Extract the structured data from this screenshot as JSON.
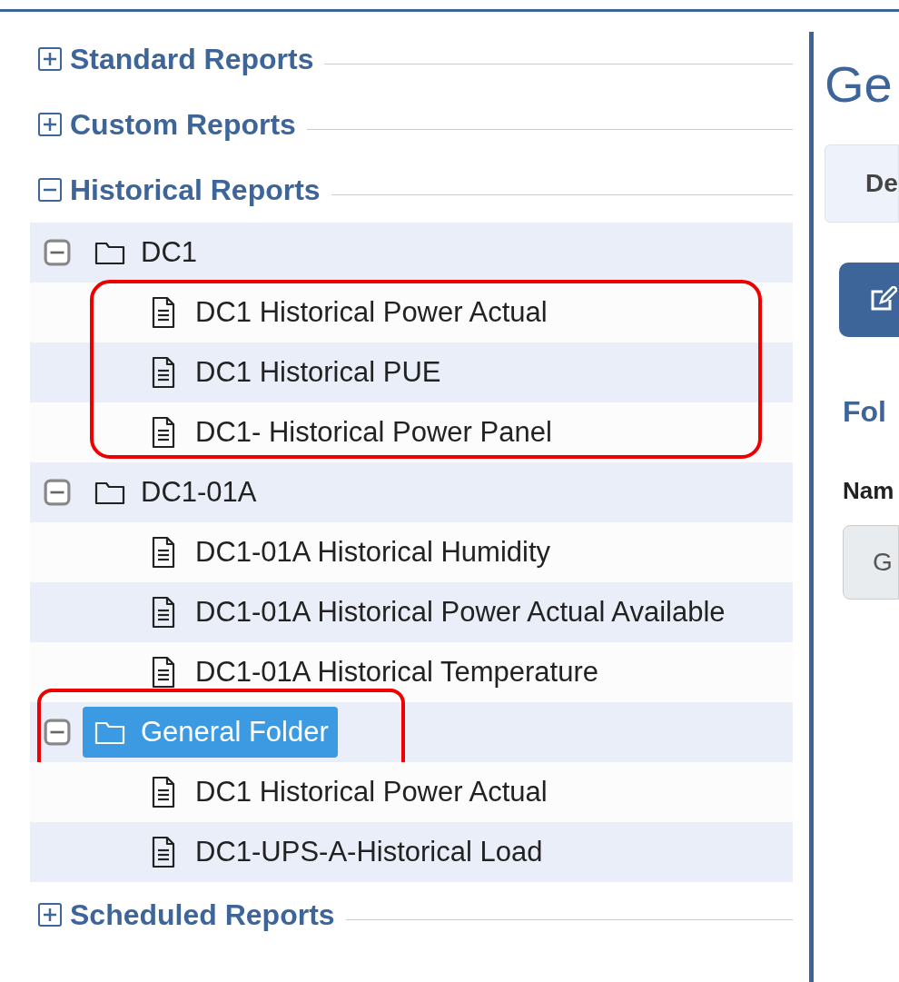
{
  "sections": [
    {
      "label": "Standard Reports",
      "expanded": false
    },
    {
      "label": "Custom Reports",
      "expanded": false
    },
    {
      "label": "Historical Reports",
      "expanded": true,
      "folders": [
        {
          "name": "DC1",
          "expanded": true,
          "selected": false,
          "highlighted": false,
          "items_highlighted": true,
          "items": [
            "DC1 Historical Power Actual",
            "DC1 Historical PUE",
            "DC1- Historical Power Panel"
          ]
        },
        {
          "name": "DC1-01A",
          "expanded": true,
          "selected": false,
          "highlighted": false,
          "items_highlighted": false,
          "items": [
            "DC1-01A Historical Humidity",
            "DC1-01A Historical Power Actual Available",
            "DC1-01A Historical Temperature"
          ]
        },
        {
          "name": "General Folder",
          "expanded": true,
          "selected": true,
          "highlighted": true,
          "items_highlighted": false,
          "items": [
            "DC1 Historical Power Actual",
            "DC1-UPS-A-Historical Load"
          ]
        }
      ]
    },
    {
      "label": "Scheduled Reports",
      "expanded": false
    }
  ],
  "detail": {
    "title": "Ge",
    "tab": "De",
    "section_heading": "Fol",
    "field_label": "Nam",
    "field_value": "G"
  }
}
